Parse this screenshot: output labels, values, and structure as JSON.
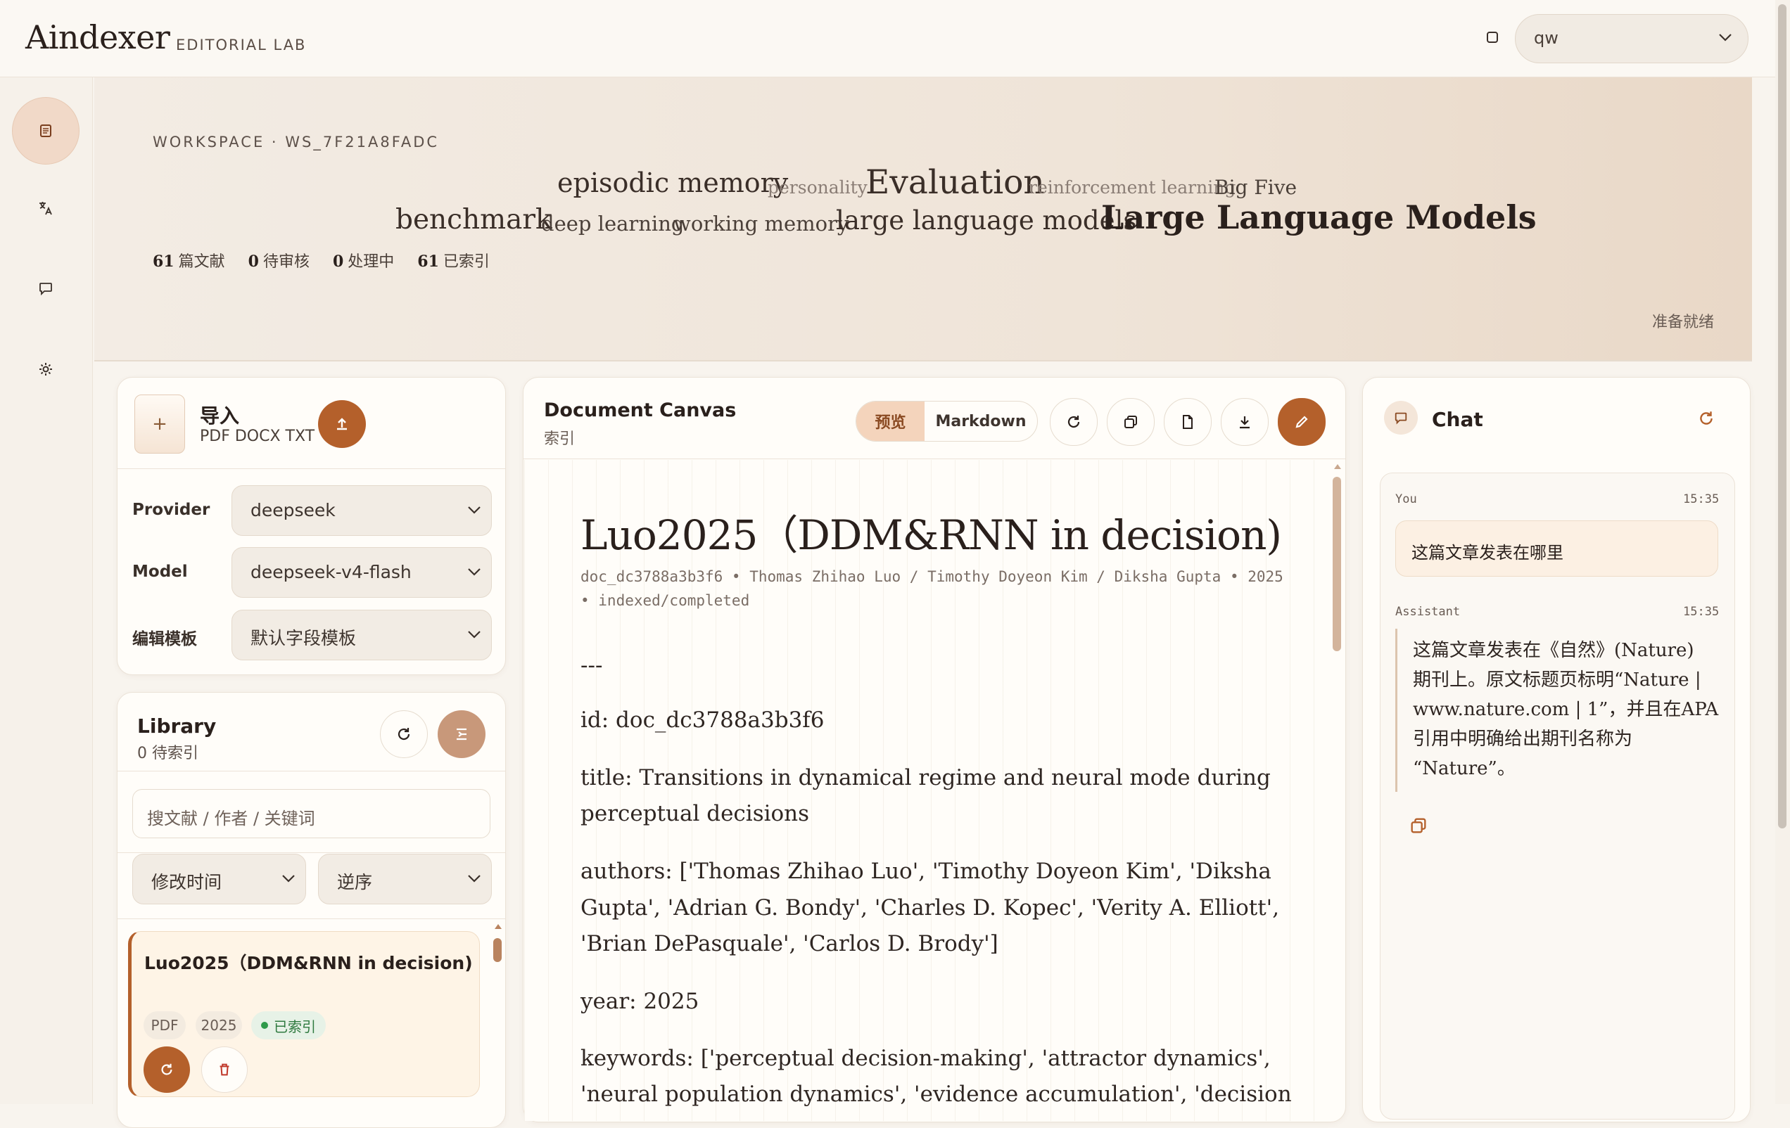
{
  "app": {
    "name": "Aindexer",
    "subtitle": "EDITORIAL LAB"
  },
  "user_select": {
    "value": "qw"
  },
  "rail": {
    "items": [
      "documents",
      "translate",
      "chat",
      "settings"
    ]
  },
  "hero": {
    "workspace": "WORKSPACE · WS_7F21A8FADC",
    "tags": [
      "episodic memory",
      "personality",
      "Evaluation",
      "reinforcement learning",
      "Big Five",
      "benchmark",
      "deep learning",
      "working memory",
      "large language models",
      "Large Language Models"
    ],
    "stats": [
      {
        "value": "61",
        "label": "篇文献"
      },
      {
        "value": "0",
        "label": "待审核"
      },
      {
        "value": "0",
        "label": "处理中"
      },
      {
        "value": "61",
        "label": "已索引"
      }
    ],
    "status": "准备就绪"
  },
  "import": {
    "plus": "+",
    "title": "导入",
    "formats": "PDF DOCX TXT",
    "provider_label": "Provider",
    "provider_value": "deepseek",
    "model_label": "Model",
    "model_value": "deepseek-v4-flash",
    "template_label": "编辑模板",
    "template_value": "默认字段模板"
  },
  "library": {
    "title": "Library",
    "pending": "0 待索引",
    "search_placeholder": "搜文献 / 作者 / 关键词",
    "sort_field": "修改时间",
    "sort_order": "逆序",
    "items": [
      {
        "title": "Luo2025（DDM&RNN in decision)",
        "type": "PDF",
        "year": "2025",
        "status": "已索引"
      }
    ]
  },
  "canvas": {
    "title": "Document Canvas",
    "subtitle": "索引",
    "tab_preview": "预览",
    "tab_markdown": "Markdown",
    "doc_title": "Luo2025（DDM&RNN in decision)",
    "meta_line1": "doc_dc3788a3b3f6  •  Thomas Zhihao Luo / Timothy Doyeon Kim / Diksha Gupta  •  2025",
    "meta_line2": "•  indexed/completed",
    "body": [
      "---",
      "id: doc_dc3788a3b3f6",
      "title: Transitions in dynamical regime and neural mode during",
      "perceptual decisions",
      "authors: ['Thomas Zhihao Luo', 'Timothy Doyeon Kim', 'Diksha",
      "Gupta', 'Adrian G. Bondy', 'Charles D. Kopec', 'Verity A. Elliott',",
      "'Brian DePasquale', 'Carlos D. Brody']",
      "year: 2025",
      "keywords: ['perceptual decision-making', 'attractor dynamics',",
      "'neural population dynamics', 'evidence accumulation', 'decision"
    ]
  },
  "chat": {
    "title": "Chat",
    "user_role": "You",
    "user_time": "15:35",
    "user_message": "这篇文章发表在哪里",
    "assistant_role": "Assistant",
    "assistant_time": "15:35",
    "assistant_lines": [
      "这篇文章发表在《自然》(Nature)",
      "期刊上。原文标题页标明“Nature |",
      "www.nature.com | 1”，并且在APA",
      "引用中明确给出期刊名称为",
      "“Nature”。"
    ]
  },
  "colors": {
    "accent": "#b4602b",
    "background": "#f8f4ee",
    "card": "#fffdf9",
    "status_green": "#2f7a3f"
  }
}
